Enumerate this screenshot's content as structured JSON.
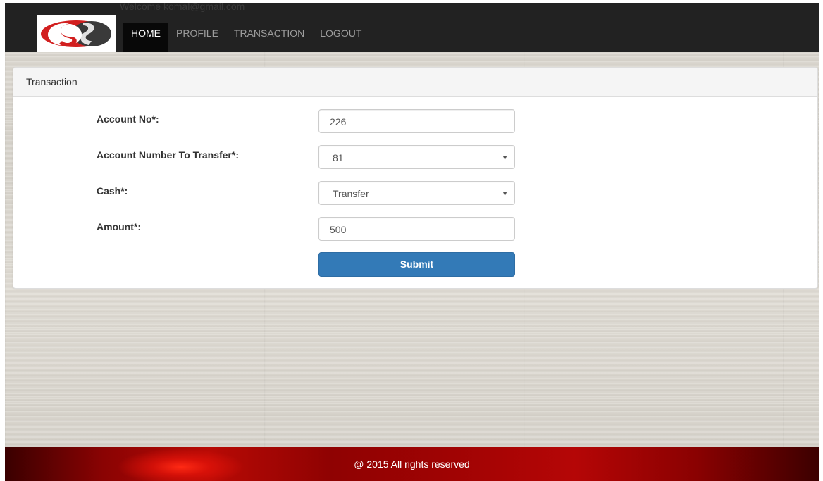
{
  "header": {
    "welcome": "Welcome komal@gmail.com",
    "nav": [
      {
        "label": "HOME",
        "active": true
      },
      {
        "label": "PROFILE",
        "active": false
      },
      {
        "label": "TRANSACTION",
        "active": false
      },
      {
        "label": "LOGOUT",
        "active": false
      }
    ]
  },
  "panel": {
    "title": "Transaction",
    "fields": [
      {
        "label": "Account No*:",
        "value": "226"
      },
      {
        "label": "Account Number To Transfer*:",
        "value": "81"
      },
      {
        "label": "Cash*:",
        "value": "Transfer"
      },
      {
        "label": "Amount*:",
        "value": "500"
      }
    ],
    "submit_label": "Submit"
  },
  "footer": {
    "text": "@ 2015 All rights reserved"
  },
  "icons": {
    "logo": "company-logo",
    "select_caret": "caret-down-icon"
  },
  "colors": {
    "navbar": "#222222",
    "primary_button": "#337ab7",
    "footer_red": "#b80a05"
  }
}
